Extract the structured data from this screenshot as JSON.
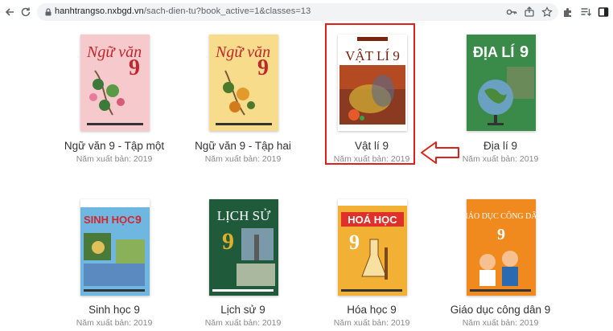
{
  "browser": {
    "url_host": "hanhtrangso.nxbgd.vn",
    "url_path": "/sach-dien-tu?book_active=1&classes=13",
    "icons": {
      "back": "back-arrow-icon",
      "reload": "reload-icon",
      "lock": "lock-icon",
      "key": "key-icon",
      "share": "share-icon",
      "star": "bookmark-star-icon",
      "extensions": "puzzle-extensions-icon",
      "reading_list": "reading-list-icon",
      "side_panel": "side-panel-icon"
    }
  },
  "books": [
    {
      "title": "Ngữ văn 9 - Tập một",
      "year_label": "Năm xuất bản: 2019",
      "cover_text": "Ngữ văn",
      "cover_number": "9",
      "cover_sub": "Tập một",
      "cover_bg": "#f6c9cd",
      "cover_fg": "#c0272d"
    },
    {
      "title": "Ngữ văn 9 - Tập hai",
      "year_label": "Năm xuất bản: 2019",
      "cover_text": "Ngữ văn",
      "cover_number": "9",
      "cover_sub": "Tập hai",
      "cover_bg": "#f7dc8c",
      "cover_fg": "#c0272d"
    },
    {
      "title": "Vật lí 9",
      "year_label": "Năm xuất bản: 2019",
      "cover_text": "VẬT LÍ 9",
      "cover_number": "",
      "cover_sub": "",
      "cover_bg": "#ffffff",
      "cover_fg": "#7a2410"
    },
    {
      "title": "Địa lí 9",
      "year_label": "Năm xuất bản: 2019",
      "cover_text": "ĐỊA LÍ",
      "cover_number": "9",
      "cover_sub": "",
      "cover_bg": "#3a8a4a",
      "cover_fg": "#ffffff"
    },
    {
      "title": "Sinh học 9",
      "year_label": "Năm xuất bản: 2019",
      "cover_text": "SINH HỌC",
      "cover_number": "9",
      "cover_sub": "",
      "cover_bg": "#6fb7e0",
      "cover_fg": "#d3262e"
    },
    {
      "title": "Lịch sử 9",
      "year_label": "Năm xuất bản: 2019",
      "cover_text": "LỊCH SỬ",
      "cover_number": "9",
      "cover_sub": "",
      "cover_bg": "#1f5a3a",
      "cover_fg": "#ffffff"
    },
    {
      "title": "Hóa học 9",
      "year_label": "Năm xuất bản: 2019",
      "cover_text": "HOÁ HỌC",
      "cover_number": "9",
      "cover_sub": "",
      "cover_bg": "#f2b134",
      "cover_fg": "#ffffff"
    },
    {
      "title": "Giáo dục công dân 9",
      "year_label": "Năm xuất bản: 2019",
      "cover_text": "GIÁO DỤC CÔNG DÂN",
      "cover_number": "9",
      "cover_sub": "",
      "cover_bg": "#f08a1e",
      "cover_fg": "#ffffff"
    }
  ],
  "annotation": {
    "highlight_color": "#e0211b",
    "arrow_icon": "left-arrow-outline-icon"
  }
}
